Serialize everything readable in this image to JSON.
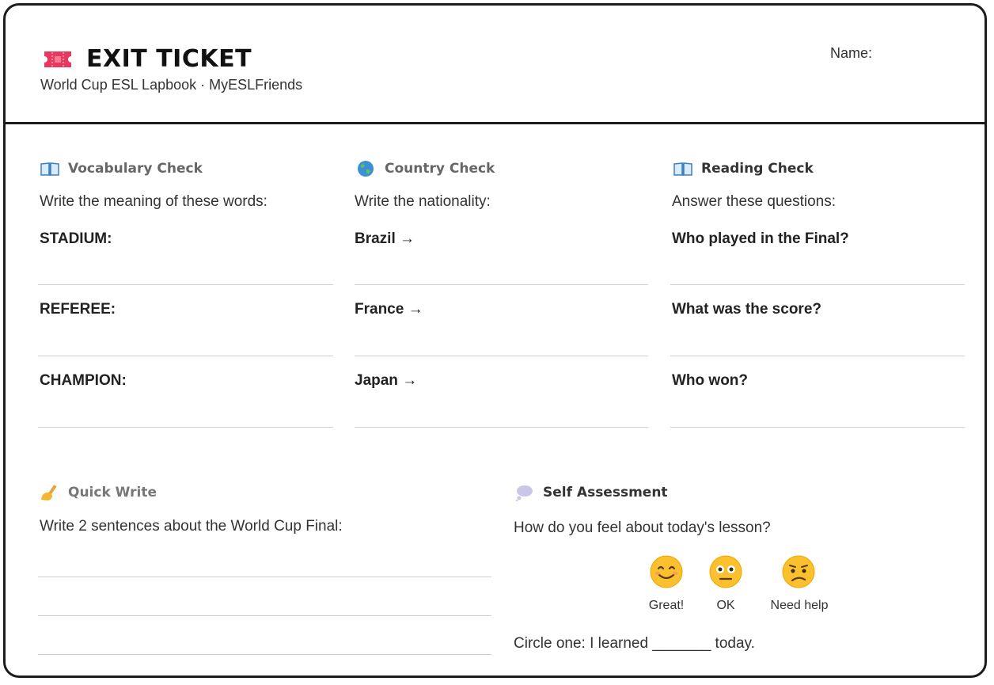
{
  "header": {
    "title": "EXIT TICKET",
    "subtitle": "World Cup ESL Lapbook · MyESLFriends",
    "name_label": "Name:",
    "icon": "ticket-icon",
    "icon_color": "#e8385f"
  },
  "vocab": {
    "icon": "open-book-icon",
    "heading": "Vocabulary Check",
    "instruction": "Write the meaning of these words:",
    "items": [
      "STADIUM:",
      "REFEREE:",
      "CHAMPION:"
    ]
  },
  "country": {
    "icon": "globe-icon",
    "heading": "Country Check",
    "instruction": "Write the nationality:",
    "items": [
      "Brazil →",
      "France →",
      "Japan →"
    ]
  },
  "reading": {
    "icon": "open-book-icon",
    "heading": "Reading Check",
    "instruction": "Answer these questions:",
    "items": [
      "Who played in the Final?",
      "What was the score?",
      "Who won?"
    ]
  },
  "quick_write": {
    "icon": "writing-hand-icon",
    "heading": "Quick Write",
    "instruction": "Write 2 sentences about the World Cup Final:"
  },
  "self_assessment": {
    "icon": "thought-bubble-icon",
    "heading": "Self Assessment",
    "question": "How do you feel about today's lesson?",
    "options": [
      {
        "icon": "smiling-face-icon",
        "label": "Great!"
      },
      {
        "icon": "neutral-face-icon",
        "label": "OK"
      },
      {
        "icon": "confused-face-icon",
        "label": "Need help"
      }
    ],
    "footer": "Circle one: I learned _______ today."
  }
}
